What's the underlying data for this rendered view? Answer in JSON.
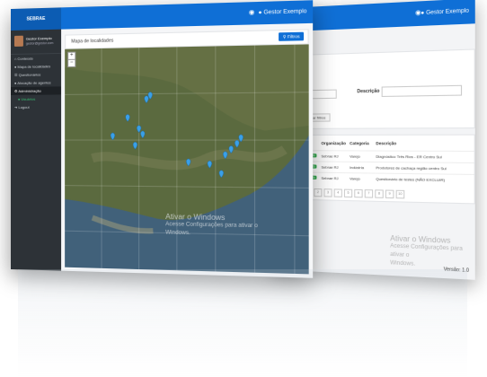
{
  "back_screen": {
    "user_label": "Gestor Exemplo",
    "description_label": "Descrição",
    "clear_filters_label": "Limpar filtros",
    "table": {
      "headers": [
        "Status",
        "Organização",
        "Categoria",
        "Descrição"
      ],
      "rows": [
        {
          "status": "Publicado",
          "org": "Sebrae RJ",
          "cat": "Varejo",
          "desc": "Diagnóstico Três Rios - ER Centro Sul"
        },
        {
          "status": "Publicado",
          "org": "Sebrae RJ",
          "cat": "Indústria",
          "desc": "Produtores de cachaça região centro Sul"
        },
        {
          "status": "Publicado",
          "org": "Sebrae RJ",
          "cat": "Varejo",
          "desc": "Questionário de testes (NÃO EXCLUIR)"
        }
      ],
      "pages": [
        "1",
        "2",
        "3",
        "4",
        "5",
        "6",
        "7",
        "8",
        "9",
        "10"
      ]
    },
    "watermark_line1": "Ativar o Windows",
    "watermark_line2": "Acesse Configurações para ativar o",
    "watermark_line3": "Windows.",
    "version_label": "Versão: 1.0"
  },
  "front_screen": {
    "logo_text": "SEBRAE",
    "user_label": "Gestor Exemplo",
    "profile": {
      "name": "Gestor Exemplo",
      "email": "gestor@gestor.com"
    },
    "sidebar": {
      "items": [
        {
          "label": "Conteúdo",
          "icon": "home-icon"
        },
        {
          "label": "Mapa de localidades",
          "icon": "map-marker-icon"
        },
        {
          "label": "Questionários",
          "icon": "list-icon"
        },
        {
          "label": "Alocação de agentes",
          "icon": "users-icon"
        },
        {
          "label": "Administração",
          "icon": "cog-icon"
        },
        {
          "label": "Usuários",
          "icon": "user-icon"
        },
        {
          "label": "Logout",
          "icon": "logout-icon"
        }
      ]
    },
    "card_title": "Mapa de localidades",
    "filters_button": "Filtros",
    "zoom_in": "+",
    "zoom_out": "−",
    "watermark_line1": "Ativar o Windows",
    "watermark_line2": "Acesse Configurações para ativar o",
    "watermark_line3": "Windows.",
    "map": {
      "land_color": "#5b6a3f",
      "water_color": "#41617a",
      "marker_color": "#3aa0e8",
      "marker_count": 14
    }
  }
}
